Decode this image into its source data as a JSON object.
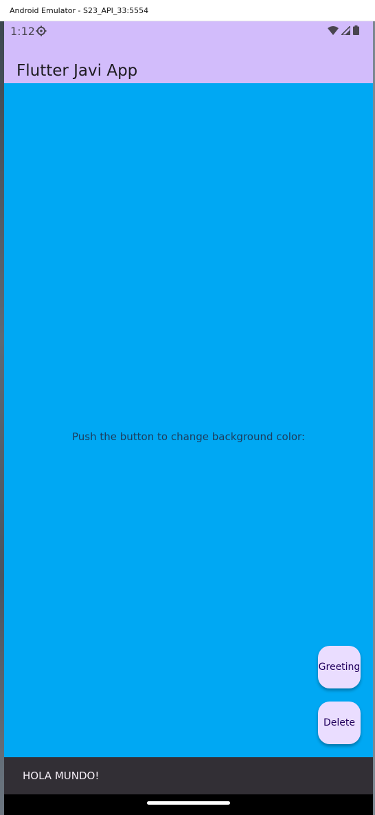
{
  "window": {
    "title": "Android Emulator - S23_API_33:5554"
  },
  "status_bar": {
    "time": "1:12",
    "icons": [
      "settings-icon",
      "wifi-icon",
      "signal-icon",
      "battery-icon"
    ]
  },
  "app_bar": {
    "title": "Flutter Javi App"
  },
  "body": {
    "message": "Push the button to change background color:",
    "background_color": "#00a8f3"
  },
  "fabs": {
    "greeting_label": "Greeting",
    "delete_label": "Delete"
  },
  "snackbar": {
    "text": "HOLA MUNDO!"
  },
  "colors": {
    "app_bar": "#d2bcfb",
    "fab": "#eaddff",
    "snackbar": "#322f35"
  }
}
